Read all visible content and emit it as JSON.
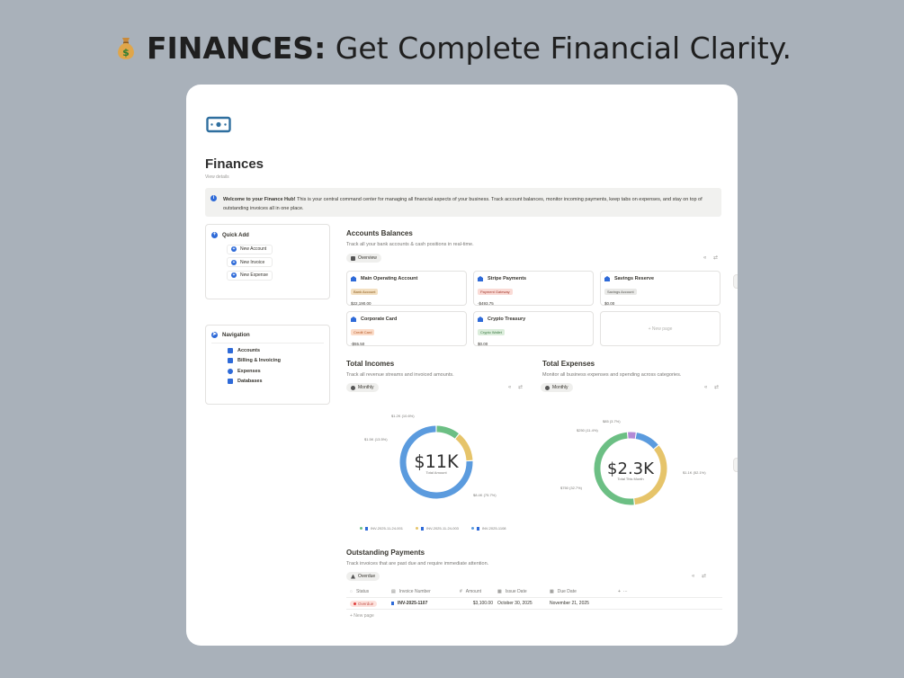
{
  "headline": {
    "bold": "FINANCES:",
    "rest": " Get Complete Financial Clarity."
  },
  "page": {
    "title": "Finances",
    "view_details": "View details",
    "callout_bold": "Welcome to your Finance Hub!",
    "callout_text": " This is your central command center for managing all financial aspects of your business. Track account balances, monitor incoming payments, keep tabs on expenses, and stay on top of outstanding invoices all in one place."
  },
  "quick_add": {
    "title": "Quick Add",
    "items": [
      "New Account",
      "New Invoice",
      "New Expense"
    ]
  },
  "navigation": {
    "title": "Navigation",
    "items": [
      "Accounts",
      "Billing & Invoicing",
      "Expenses",
      "Databases"
    ]
  },
  "accounts": {
    "title": "Accounts Balances",
    "desc": "Track all your bank accounts & cash positions in real-time.",
    "view": "Overview",
    "controls": "« ⇄",
    "cards": [
      {
        "name": "Main Operating Account",
        "tag": "Bank Account",
        "tag_color": "#f3e0c2",
        "tag_text": "#8c5a1a",
        "balance": "$22,190.00"
      },
      {
        "name": "Stripe Payments",
        "tag": "Payment Gateway",
        "tag_color": "#fadbd6",
        "tag_text": "#a3392d",
        "balance": "-$493.75"
      },
      {
        "name": "Savings Reserve",
        "tag": "Savings Account",
        "tag_color": "#e9e9e7",
        "tag_text": "#555550",
        "balance": "$0.00"
      },
      {
        "name": "Corporate Card",
        "tag": "Credit Card",
        "tag_color": "#fbdcc9",
        "tag_text": "#b4541e",
        "balance": "-$55.50"
      },
      {
        "name": "Crypto Treasury",
        "tag": "Crypto Wallet",
        "tag_color": "#dbeddb",
        "tag_text": "#3c7a44",
        "balance": "$0.00"
      }
    ],
    "new_page": "+ New page"
  },
  "incomes": {
    "title": "Total Incomes",
    "desc": "Track all revenue streams and invoiced amounts.",
    "view": "Monthly",
    "controls": "« ⇄",
    "center_value": "$11K",
    "center_label": "Total Amount",
    "annotations": [
      "$1.2K (10.6%)",
      "$1.5K (13.5%)",
      "$8.4K (75.7%)"
    ],
    "legend": [
      "INV-2025-11-24-001",
      "INV-2025-11-24-003",
      "INV-2025-1108"
    ]
  },
  "expenses": {
    "title": "Total Expenses",
    "desc": "Monitor all business expenses and spending across categories.",
    "view": "Monthly",
    "controls": "« ⇄",
    "center_value": "$2.3K",
    "center_label": "Total This Month",
    "annotations": [
      "$85 (3.7%)",
      "$250 (11.4%)",
      "$750 (32.7%)",
      "$1.1K (52.1%)"
    ]
  },
  "outstanding": {
    "title": "Outstanding Payments",
    "desc": "Track invoices that are past due and require immediate attention.",
    "view": "Overdue",
    "controls": "« ⇄",
    "columns": [
      "Status",
      "Invoice Number",
      "Amount",
      "Issue Date",
      "Due Date"
    ],
    "row": {
      "status": "Overdue",
      "invoice": "INV-2025-1107",
      "amount": "$3,100.00",
      "issue_date": "October 30, 2025",
      "due_date": "November 21, 2025"
    },
    "new_page": "+ New page"
  },
  "chart_data": [
    {
      "type": "pie",
      "title": "Total Incomes",
      "center": "$11K",
      "categories": [
        "INV-2025-11-24-001",
        "INV-2025-11-24-003",
        "INV-2025-1108"
      ],
      "values": [
        1.2,
        1.5,
        8.4
      ],
      "percent": [
        10.6,
        13.5,
        75.7
      ],
      "colors": [
        "#6cbf84",
        "#e6c46a",
        "#5b9bde"
      ]
    },
    {
      "type": "pie",
      "title": "Total Expenses",
      "center": "$2.3K",
      "values": [
        0.085,
        0.25,
        0.75,
        1.1
      ],
      "percent": [
        3.7,
        11.4,
        32.7,
        52.1
      ],
      "colors": [
        "#b38ad6",
        "#5b9bde",
        "#e6c46a",
        "#6cbf84"
      ]
    }
  ]
}
